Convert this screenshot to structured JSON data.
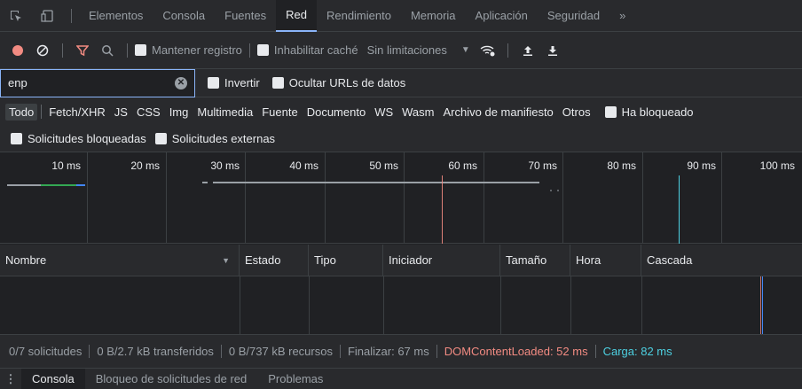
{
  "tabs": [
    "Elementos",
    "Consola",
    "Fuentes",
    "Red",
    "Rendimiento",
    "Memoria",
    "Aplicación",
    "Seguridad"
  ],
  "active_tab": "Red",
  "more_tabs": "»",
  "toolbar": {
    "preserve_log": "Mantener registro",
    "disable_cache": "Inhabilitar caché",
    "throttling": "Sin limitaciones",
    "colors": {
      "record": "#f28b82",
      "filter": "#f28b82",
      "accent": "#8ab4f8"
    }
  },
  "filter": {
    "value": "enp",
    "invert": "Invertir",
    "hide_data_urls": "Ocultar URLs de datos"
  },
  "types": [
    "Todo",
    "Fetch/XHR",
    "JS",
    "CSS",
    "Img",
    "Multimedia",
    "Fuente",
    "Documento",
    "WS",
    "Wasm",
    "Archivo de manifiesto",
    "Otros"
  ],
  "active_type": "Todo",
  "has_blocked": "Ha bloqueado",
  "blocked_requests": "Solicitudes bloqueadas",
  "third_party": "Solicitudes externas",
  "timeline_ticks": [
    "10 ms",
    "20 ms",
    "30 ms",
    "40 ms",
    "50 ms",
    "60 ms",
    "70 ms",
    "80 ms",
    "90 ms",
    "100 ms"
  ],
  "columns": [
    "Nombre",
    "Estado",
    "Tipo",
    "Iniciador",
    "Tamaño",
    "Hora",
    "Cascada"
  ],
  "status": {
    "requests": "0/7 solicitudes",
    "transferred": "0 B/2.7 kB transferidos",
    "resources": "0 B/737 kB recursos",
    "finish": "Finalizar: 67 ms",
    "dom_loaded": "DOMContentLoaded: 52 ms",
    "load": "Carga: 82 ms",
    "dom_color": "#f28b82",
    "load_color": "#4dd0e1"
  },
  "drawer_tabs": [
    "Consola",
    "Bloqueo de solicitudes de red",
    "Problemas"
  ]
}
